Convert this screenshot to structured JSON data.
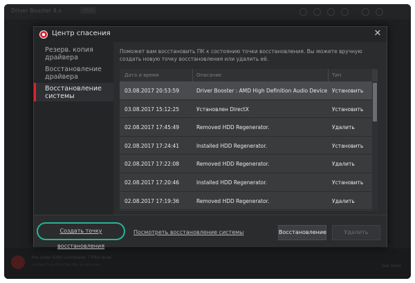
{
  "background_app": {
    "title": "Driver Booster 4.x",
    "version_badge": "PRO",
    "promo_line1": "Pre-order IObit Uninstaller 7 PRO Now!",
    "promo_line2": "Limited Time Only! Pre Buy to get more",
    "promo_link": "Get more"
  },
  "dialog": {
    "title": "Центр спасения",
    "close_glyph": "✕"
  },
  "sidebar": {
    "items": [
      {
        "label": "Резерв. копия\nдрайвера",
        "active": false
      },
      {
        "label": "Восстановление\nдрайвера",
        "active": false
      },
      {
        "label": "Восстановление\nсистемы",
        "active": true
      }
    ]
  },
  "content": {
    "description": "Поможет вам восстановить ПК к состоянию точки восстановления. Вы можете вручную создать новую точку восстановления или удалить её.",
    "columns": {
      "date": "Дата и время",
      "desc": "Описание",
      "type": "Тип"
    },
    "rows": [
      {
        "date": "03.08.2017 20:53:59",
        "desc": "Driver Booster : AMD High Definition Audio Device",
        "type": "Установить",
        "selected": true
      },
      {
        "date": "03.08.2017 15:12:25",
        "desc": "Установлен DirectX",
        "type": "Установить",
        "selected": false
      },
      {
        "date": "02.08.2017 17:45:49",
        "desc": "Removed HDD Regenerator.",
        "type": "Удалить",
        "selected": false
      },
      {
        "date": "02.08.2017 17:24:41",
        "desc": "Installed HDD Regenerator.",
        "type": "Установить",
        "selected": false
      },
      {
        "date": "02.08.2017 17:22:08",
        "desc": "Removed HDD Regenerator.",
        "type": "Удалить",
        "selected": false
      },
      {
        "date": "02.08.2017 17:20:46",
        "desc": "Installed HDD Regenerator.",
        "type": "Установить",
        "selected": false
      },
      {
        "date": "02.08.2017 17:19:36",
        "desc": "Removed HDD Regenerator.",
        "type": "Удалить",
        "selected": false
      }
    ]
  },
  "footer": {
    "create_link": "Создать точку восстановления",
    "view_link": "Посмотреть восстановление системы",
    "restore_button": "Восстановление",
    "delete_button": "Удалить"
  },
  "colors": {
    "accent_red": "#d9232e",
    "highlight_green": "#26b59a"
  }
}
